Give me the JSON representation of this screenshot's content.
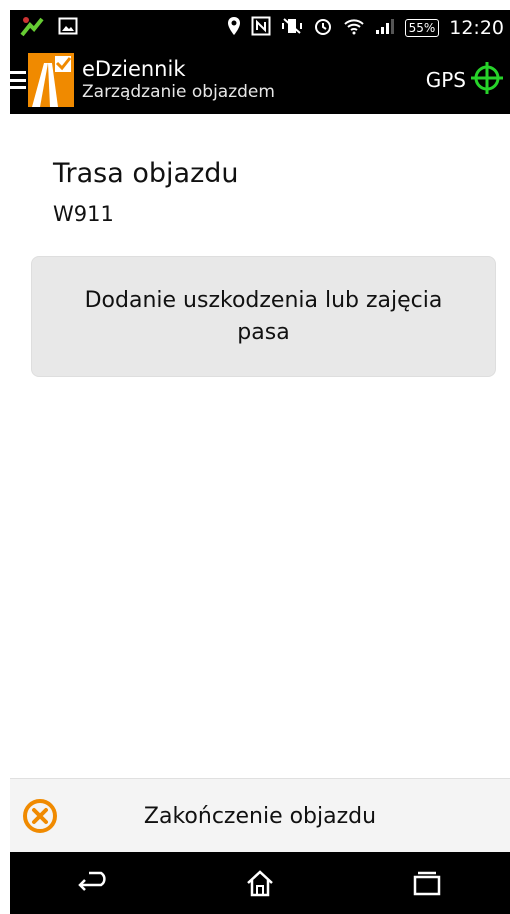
{
  "status_bar": {
    "battery_level": "55%",
    "time": "12:20",
    "icons": [
      "app-notification-icon",
      "image-icon",
      "location-icon",
      "nfc-icon",
      "vibrate-off-icon",
      "alarm-icon",
      "wifi-icon",
      "signal-icon",
      "battery-icon"
    ]
  },
  "action_bar": {
    "title": "eDziennik",
    "subtitle": "Zarządzanie objazdem",
    "gps_label": "GPS",
    "gps_icon_color": "#27d32a"
  },
  "main": {
    "route_heading": "Trasa objazdu",
    "route_code": "W911",
    "add_damage_button": "Dodanie uszkodzenia lub zajęcia pasa"
  },
  "bottom": {
    "end_route_button": "Zakończenie objazdu",
    "cancel_icon_color": "#f08a00"
  },
  "nav_bar": {
    "icons": [
      "back-icon",
      "home-icon",
      "recent-apps-icon"
    ]
  }
}
